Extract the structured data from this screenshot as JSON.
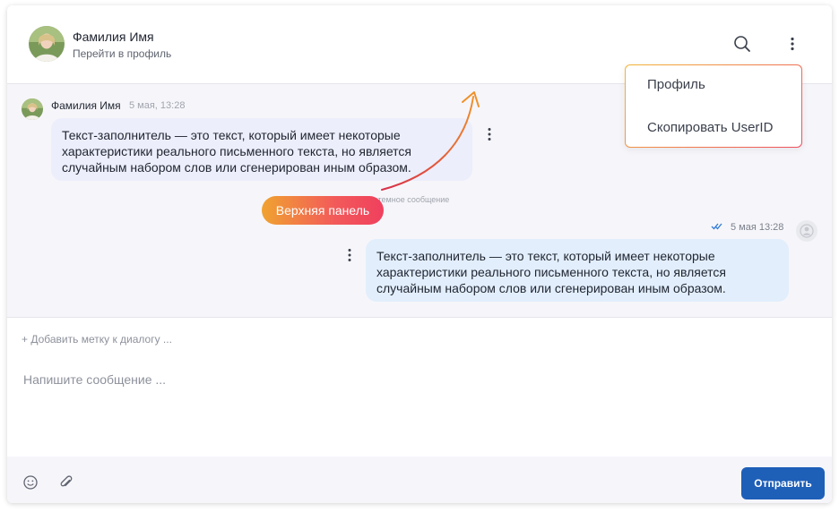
{
  "header": {
    "contact_name": "Фамилия Имя",
    "profile_link": "Перейти в профиль",
    "icons": [
      "search-icon",
      "more-vertical-icon"
    ]
  },
  "dropdown": {
    "items": [
      {
        "label": "Профиль"
      },
      {
        "label": "Скопировать UserID"
      }
    ]
  },
  "messages": {
    "incoming": {
      "sender": "Фамилия Имя",
      "time": "5 мая, 13:28",
      "text": "Текст-заполнитель — это текст, который имеет некоторые характеристики реального письменного текста, но является случайным набором слов или сгенерирован иным образом."
    },
    "system_message": "истемное сообщение",
    "annotation_pill": "Верхняя панель",
    "outgoing": {
      "time": "5 мая 13:28",
      "status_icon": "double-check-icon",
      "text": "Текст-заполнитель — это текст, который имеет некоторые характеристики реального письменного текста, но является случайным набором слов или сгенерирован иным образом."
    }
  },
  "label_row": {
    "add_label": "+ Добавить метку к диалогу ..."
  },
  "composer": {
    "placeholder": "Напишите сообщение ...",
    "send_label": "Отправить",
    "icons": [
      "emoji-icon",
      "attach-icon"
    ]
  },
  "colors": {
    "accent": "#1e5fb8",
    "incoming_bubble": "#eceefb",
    "outgoing_bubble": "#e2eefc",
    "pill_gradient_start": "#f0a330",
    "pill_gradient_end": "#f0405e"
  }
}
